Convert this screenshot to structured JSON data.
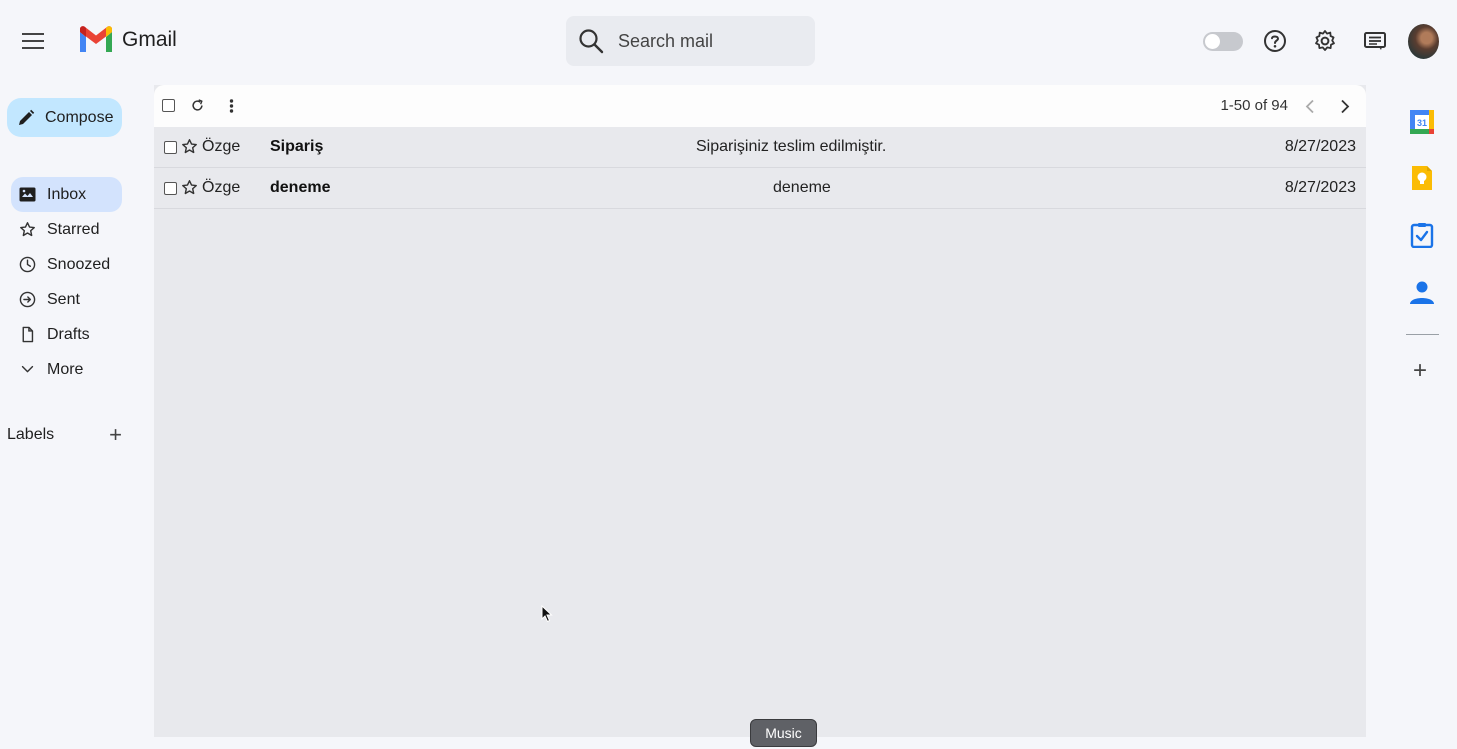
{
  "app": {
    "name": "Gmail"
  },
  "search": {
    "placeholder": "Search mail"
  },
  "compose": {
    "label": "Compose"
  },
  "nav": {
    "items": [
      {
        "label": "Inbox",
        "icon": "inbox-icon",
        "active": true
      },
      {
        "label": "Starred",
        "icon": "star-icon"
      },
      {
        "label": "Snoozed",
        "icon": "clock-icon"
      },
      {
        "label": "Sent",
        "icon": "sent-icon"
      },
      {
        "label": "Drafts",
        "icon": "draft-icon"
      },
      {
        "label": "More",
        "icon": "chevron-down-icon"
      }
    ]
  },
  "labels": {
    "title": "Labels",
    "add": "+"
  },
  "toolbar": {
    "pagination": "1-50 of 94"
  },
  "emails": [
    {
      "sender": "Özge",
      "subject": "Sipariş",
      "snippet": "Siparişiniz teslim edilmiştir.",
      "date": "8/27/2023"
    },
    {
      "sender": "Özge",
      "subject": "deneme",
      "snippet": "deneme",
      "date": "8/27/2023"
    }
  ],
  "side_panel": {
    "calendar_day": "31",
    "add": "+"
  },
  "tooltip": {
    "text": "Music"
  },
  "colors": {
    "compose_bg": "#c2e7ff",
    "inbox_active_bg": "#d3e3fd",
    "search_bg": "#e9ebf0"
  }
}
